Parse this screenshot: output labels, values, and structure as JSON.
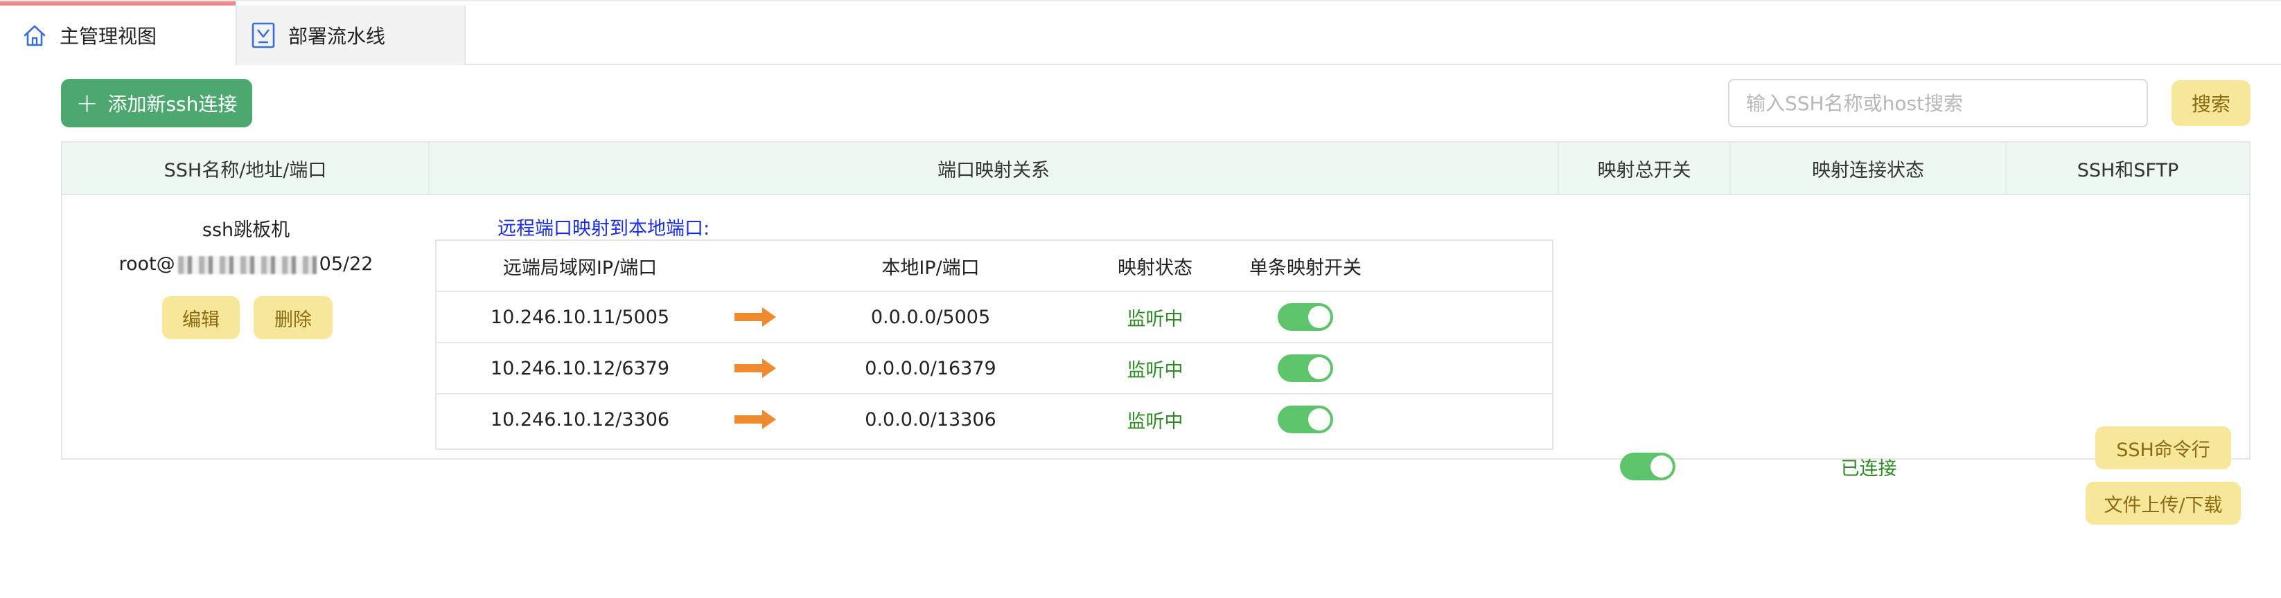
{
  "tabs": [
    {
      "label": "主管理视图",
      "icon": "home-icon",
      "active": true
    },
    {
      "label": "部署流水线",
      "icon": "pipeline-icon",
      "active": false
    }
  ],
  "toolbar": {
    "add_label": "添加新ssh连接",
    "search_placeholder": "输入SSH名称或host搜索",
    "search_value": "",
    "search_label": "搜索"
  },
  "table": {
    "headers": [
      "SSH名称/地址/端口",
      "端口映射关系",
      "映射总开关",
      "映射连接状态",
      "SSH和SFTP"
    ],
    "rows": [
      {
        "ssh_name": "ssh跳板机",
        "ssh_host_prefix": "root@",
        "ssh_host_suffix": "05/22",
        "edit_label": "编辑",
        "delete_label": "删除",
        "mapping_title": "远程端口映射到本地端口:",
        "mapping_headers": [
          "远端局域网IP/端口",
          "本地IP/端口",
          "映射状态",
          "单条映射开关"
        ],
        "mappings": [
          {
            "remote": "10.246.10.11/5005",
            "local": "0.0.0.0/5005",
            "status": "监听中",
            "enabled": true
          },
          {
            "remote": "10.246.10.12/6379",
            "local": "0.0.0.0/16379",
            "status": "监听中",
            "enabled": true
          },
          {
            "remote": "10.246.10.12/3306",
            "local": "0.0.0.0/13306",
            "status": "监听中",
            "enabled": true
          }
        ],
        "master_enabled": true,
        "connection_status": "已连接",
        "ssh_cmd_label": "SSH命令行",
        "file_label": "文件上传/下载"
      }
    ]
  },
  "colors": {
    "primary_green": "#4da86f",
    "yellow_button": "#f7e79a",
    "switch_on": "#5ec46b",
    "status_green": "#2f8a25",
    "arrow_orange": "#f08a2e",
    "link_blue": "#1a2ee0"
  }
}
